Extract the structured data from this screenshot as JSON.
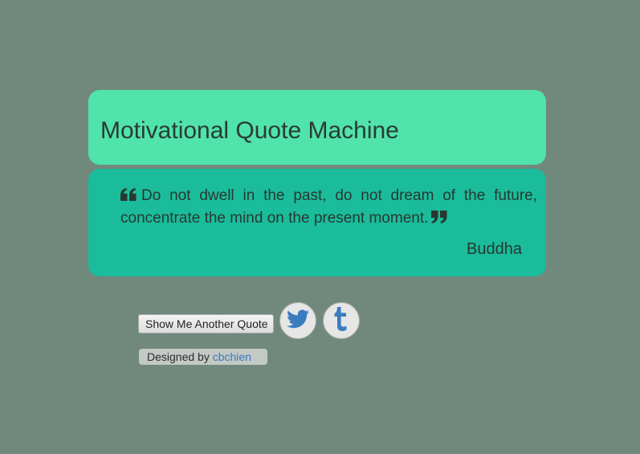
{
  "header": {
    "title": "Motivational Quote Machine"
  },
  "quote": {
    "text": "Do not dwell in the past, do not dream of the future, concentrate the mind on the present moment.",
    "author": "Buddha"
  },
  "actions": {
    "another_quote_label": "Show Me Another Quote",
    "twitter_icon": "twitter-icon",
    "tumblr_icon": "tumblr-icon"
  },
  "credit": {
    "prefix": "Designed by",
    "author_link": "cbchien"
  },
  "colors": {
    "background": "#71897c",
    "header_card": "#50e3ab",
    "quote_card": "#1abc9c",
    "icon_blue": "#3b7bbf"
  }
}
